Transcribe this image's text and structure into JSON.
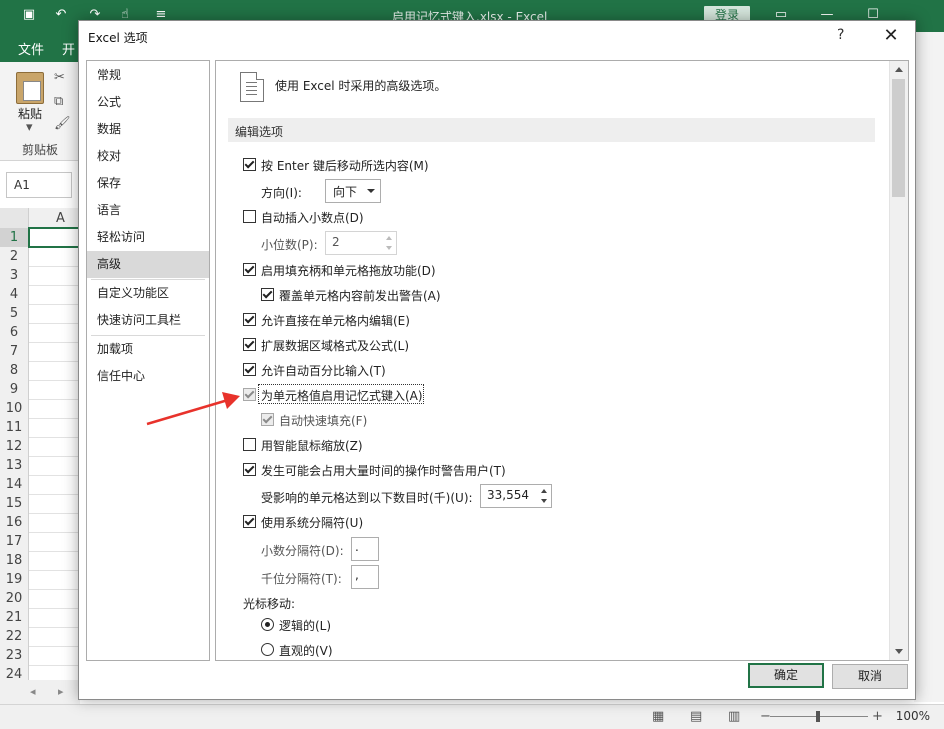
{
  "excel": {
    "window_title": "启用记忆式键入.xlsx  -  Excel",
    "login_label": "登录",
    "file_tab": "文件",
    "second_tab_partial": "开",
    "paste_label": "粘贴",
    "clipboard_group": "剪贴板",
    "name_box": "A1",
    "column_a": "A",
    "rows": [
      "1",
      "2",
      "3",
      "4",
      "5",
      "6",
      "7",
      "8",
      "9",
      "10",
      "11",
      "12",
      "13",
      "14",
      "15",
      "16",
      "17",
      "18",
      "19",
      "20",
      "21",
      "22",
      "23",
      "24"
    ],
    "zoom": "100%"
  },
  "dialog": {
    "title": "Excel 选项",
    "help": "?",
    "close": "✕",
    "nav": [
      "常规",
      "公式",
      "数据",
      "校对",
      "保存",
      "语言",
      "轻松访问",
      "高级",
      "自定义功能区",
      "快速访问工具栏",
      "加载项",
      "信任中心"
    ],
    "header_text": "使用 Excel 时采用的高级选项。",
    "section_title": "编辑选项",
    "options": {
      "move_after_enter": "按 Enter 键后移动所选内容(M)",
      "direction_label": "方向(I):",
      "direction_value": "向下",
      "auto_decimal": "自动插入小数点(D)",
      "places_label": "小位数(P):",
      "places_value": "2",
      "fill_handle": "启用填充柄和单元格拖放功能(D)",
      "alert_overwrite": "覆盖单元格内容前发出警告(A)",
      "edit_in_cell": "允许直接在单元格内编辑(E)",
      "extend_formats": "扩展数据区域格式及公式(L)",
      "auto_percent": "允许自动百分比输入(T)",
      "autocomplete": "为单元格值启用记忆式键入(A)",
      "flash_fill": "自动快速填充(F)",
      "intellimouse_zoom": "用智能鼠标缩放(Z)",
      "alert_long_op": "发生可能会占用大量时间的操作时警告用户(T)",
      "cells_affected_label": "受影响的单元格达到以下数目时(千)(U):",
      "cells_affected_value": "33,554",
      "system_separators": "使用系统分隔符(U)",
      "decimal_sep_label": "小数分隔符(D):",
      "decimal_sep_value": ".",
      "thousands_sep_label": "千位分隔符(T):",
      "thousands_sep_value": ",",
      "cursor_movement": "光标移动:",
      "logical": "逻辑的(L)",
      "visual": "直观的(V)"
    },
    "ok": "确定",
    "cancel": "取消"
  },
  "colors": {
    "excel_green": "#217346",
    "arrow_red": "#e8322b"
  }
}
